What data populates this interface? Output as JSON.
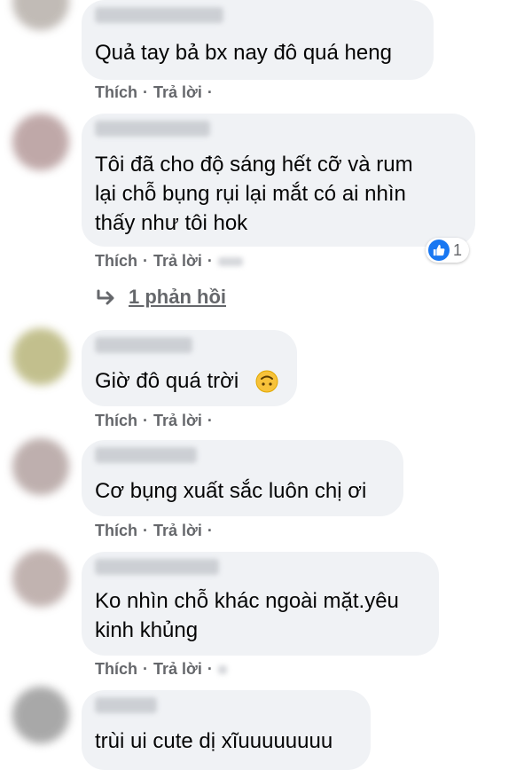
{
  "comments": [
    {
      "text_lines": [
        "Quả tay bả bx nay đô quá heng"
      ],
      "like_label": "Thích",
      "reply_label": "Trả lời",
      "separator": "·"
    },
    {
      "text_lines": [
        "Tôi đã cho độ sáng hết cỡ và rum",
        "lại chỗ bụng rụi lại mắt có ai nhìn",
        "thấy như tôi hok"
      ],
      "like_label": "Thích",
      "reply_label": "Trả lời",
      "separator": "·",
      "reaction": {
        "icon": "like-icon",
        "count": "1"
      },
      "replies_link": "1 phản hồi"
    },
    {
      "text_lines": [
        "Giờ đô quá trời"
      ],
      "emoji": "upside-down-face-icon",
      "like_label": "Thích",
      "reply_label": "Trả lời",
      "separator": "·"
    },
    {
      "text_lines": [
        "Cơ bụng xuất sắc luôn chị ơi"
      ],
      "like_label": "Thích",
      "reply_label": "Trả lời",
      "separator": "·"
    },
    {
      "text_lines": [
        "Ko nhìn chỗ khác ngoài mặt.yêu",
        "kinh khủng"
      ],
      "like_label": "Thích",
      "reply_label": "Trả lời",
      "separator": "·"
    },
    {
      "text_lines": [
        "trùi ui cute dị xĩuuuuuuuu"
      ]
    }
  ],
  "colors": {
    "bubble": "#f0f2f5",
    "text": "#050505",
    "meta": "#65676b",
    "like_blue": "#1877f2"
  }
}
